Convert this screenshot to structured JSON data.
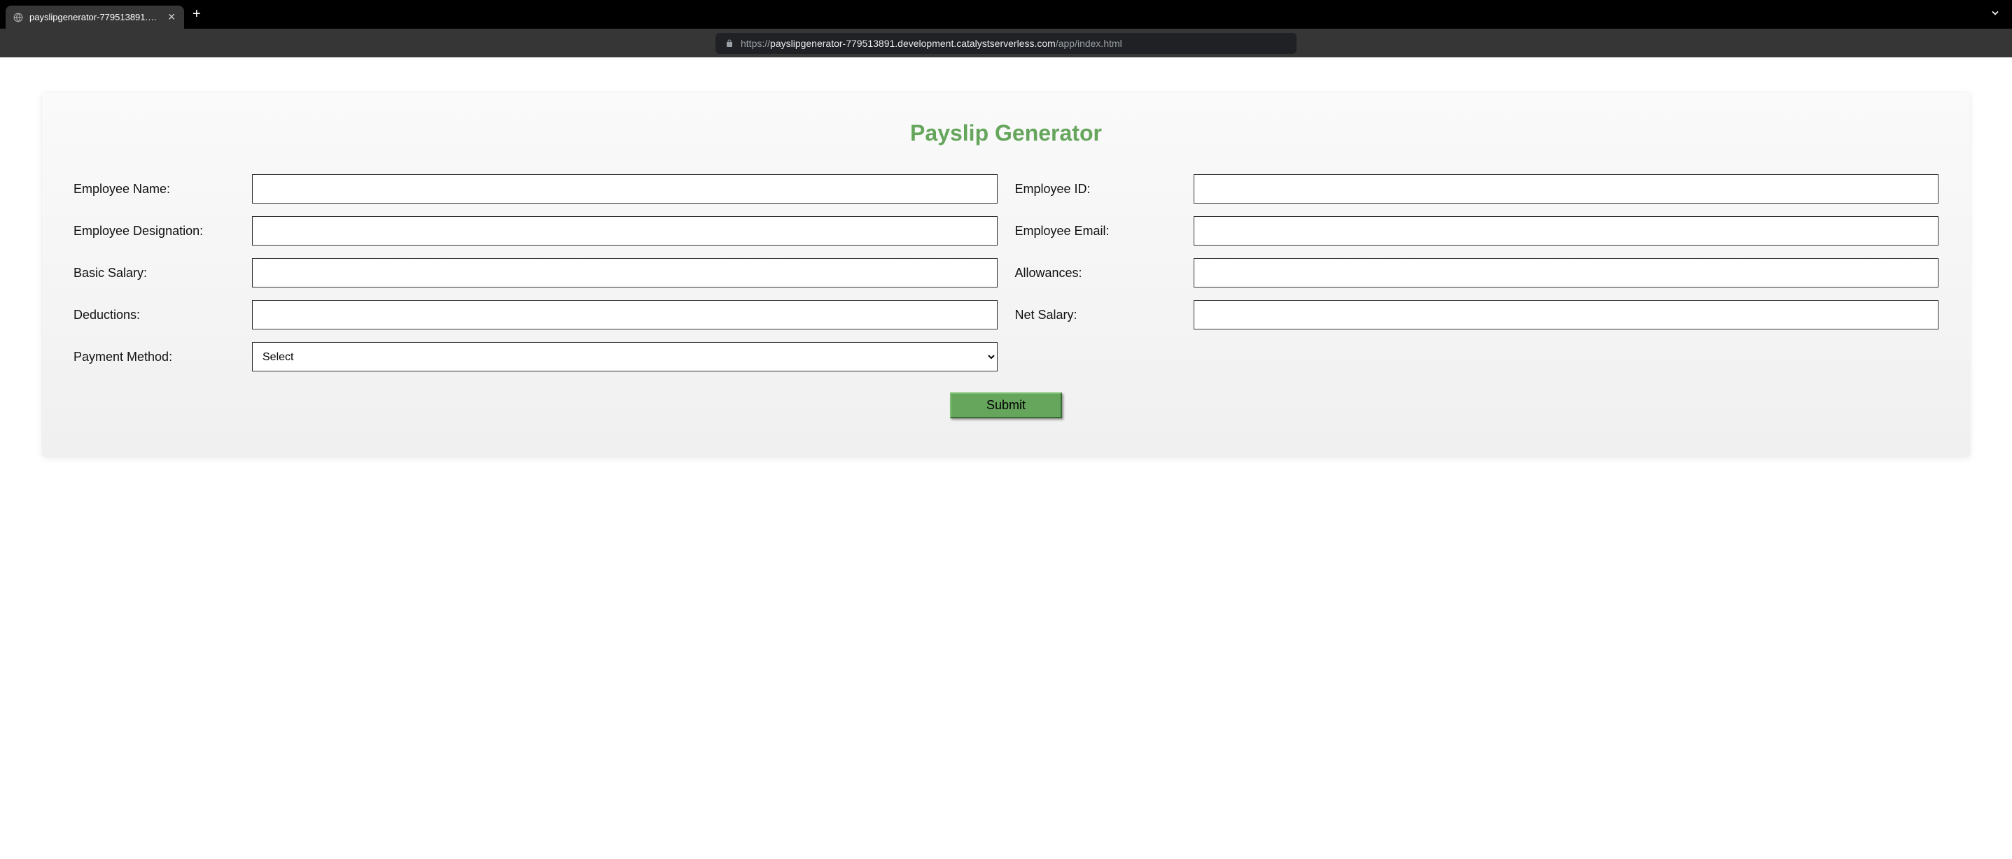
{
  "browser": {
    "tab_title": "payslipgenerator-779513891.d…",
    "url_prefix": "https://",
    "url_host": "payslipgenerator-779513891.development.catalystserverless.com",
    "url_path": "/app/index.html"
  },
  "page": {
    "title": "Payslip Generator",
    "labels": {
      "employee_name": "Employee Name:",
      "employee_id": "Employee ID:",
      "employee_designation": "Employee Designation:",
      "employee_email": "Employee Email:",
      "basic_salary": "Basic Salary:",
      "allowances": "Allowances:",
      "deductions": "Deductions:",
      "net_salary": "Net Salary:",
      "payment_method": "Payment Method:"
    },
    "payment_method_selected": "Select",
    "submit_label": "Submit"
  }
}
